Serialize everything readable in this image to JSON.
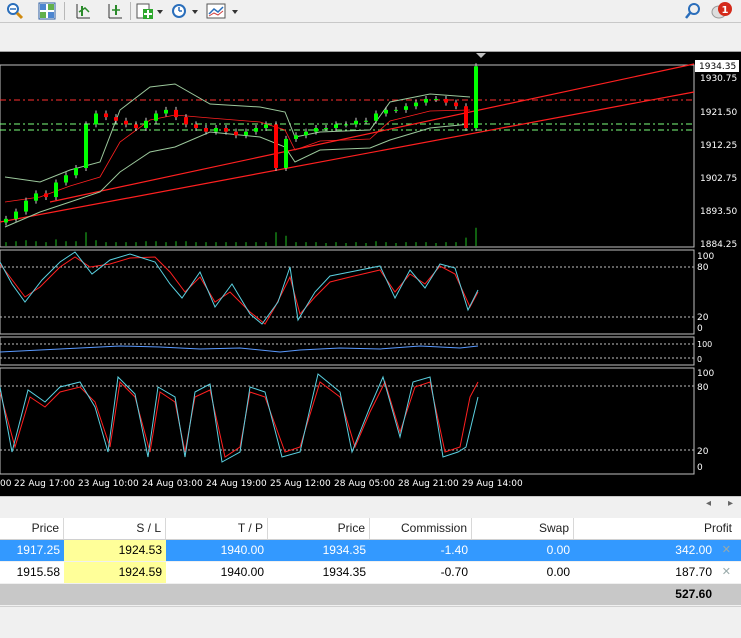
{
  "toolbar": {
    "buttons": [
      "zoom-out-icon",
      "tile-windows-icon",
      "period-separator-icon",
      "indicators-icon",
      "periodicity-icon",
      "templates-icon",
      "search-icon",
      "notifications-icon"
    ],
    "notification_count": "1"
  },
  "chart": {
    "current_price": "1934.35",
    "price_ticks": [
      "1930.75",
      "1921.50",
      "1912.25",
      "1902.75",
      "1893.50",
      "1884.25"
    ],
    "osc1_ticks": [
      "100",
      "80",
      "20",
      "0"
    ],
    "osc2_ticks": [
      "100",
      "0"
    ],
    "osc3_ticks": [
      "100",
      "80",
      "20",
      "0"
    ],
    "time_labels": [
      "00",
      "22 Aug 17:00",
      "23 Aug 10:00",
      "24 Aug 03:00",
      "24 Aug 19:00",
      "25 Aug 12:00",
      "28 Aug 05:00",
      "28 Aug 21:00",
      "29 Aug 14:00"
    ]
  },
  "chart_data": {
    "type": "line",
    "ylim": [
      1884.25,
      1934.35
    ],
    "series": [
      {
        "values": [
          1892,
          1894,
          1897,
          1899,
          1898,
          1902,
          1904,
          1906,
          1918,
          1921,
          1920,
          1919,
          1918,
          1917,
          1919,
          1921,
          1922,
          1920,
          1918,
          1917,
          1916,
          1917,
          1916,
          1915,
          1916,
          1917,
          1918,
          1906,
          1914,
          1915,
          1916,
          1917,
          1917,
          1918,
          1918,
          1919,
          1919,
          1921,
          1922,
          1922,
          1923,
          1924,
          1925,
          1925,
          1924,
          1923,
          1917,
          1934
        ]
      }
    ]
  },
  "positions": {
    "headers": [
      "Price",
      "S / L",
      "T / P",
      "Price",
      "Commission",
      "Swap",
      "Profit"
    ],
    "rows": [
      {
        "price": "1917.25",
        "sl": "1924.53",
        "tp": "1940.00",
        "cur": "1934.35",
        "commission": "-1.40",
        "swap": "0.00",
        "profit": "342.00"
      },
      {
        "price": "1915.58",
        "sl": "1924.59",
        "tp": "1940.00",
        "cur": "1934.35",
        "commission": "-0.70",
        "swap": "0.00",
        "profit": "187.70"
      }
    ],
    "total_profit": "527.60"
  },
  "colors": {
    "candle_up": "#00ff00",
    "candle_down": "#ff0000",
    "line_red": "#ff2020",
    "band": "#9cc89c",
    "axis": "#ffffff",
    "selected_row": "#3399ff",
    "sl_highlight": "#ffff99"
  }
}
